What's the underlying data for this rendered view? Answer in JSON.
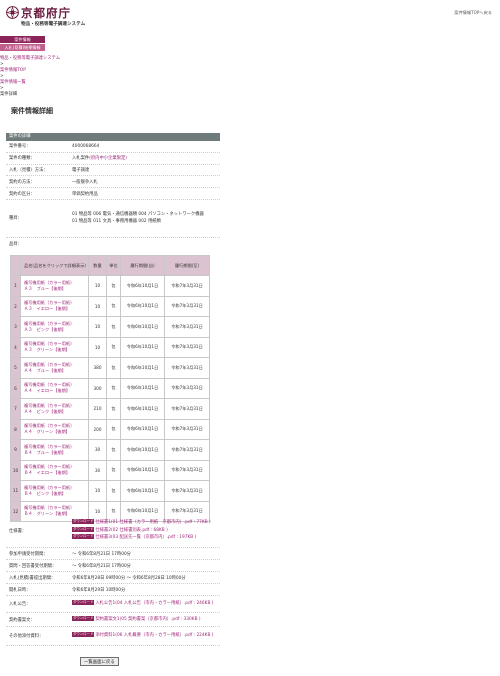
{
  "header": {
    "logo_title": "京都府庁",
    "logo_subtitle": "物品・役務等電子調達システム",
    "top_link": "案件情報TOPへ戻る"
  },
  "menu": [
    "案件情報",
    "入札(見積)結果情報"
  ],
  "breadcrumb": {
    "items": [
      "物品・役務等電子調達システム",
      "案件情報TOP",
      "案件情報一覧",
      "案件詳細"
    ],
    "separator": ">"
  },
  "page_title": "案件情報詳細",
  "detail": {
    "section_title": "案件の詳細",
    "case_number": {
      "label": "案件番号：",
      "value": "4000068664"
    },
    "case_type": {
      "label": "案件の種類：",
      "value": "入札案件",
      "tag": "(府内中小企業限定)"
    },
    "bid_method": {
      "label": "入札（見積）方法：",
      "value": "電子調達"
    },
    "contract_method": {
      "label": "契約の方法：",
      "value": "一般競争入札"
    },
    "contract_category": {
      "label": "契約の区分：",
      "value": "単価契約用品"
    },
    "category": {
      "label": "種目：",
      "line1": "01 物品等 006 電気・通信機器類 004 パソコン・ネットワーク機器",
      "line2": "01 物品等 011 文具・事務用機器 002 用紙類"
    },
    "items_label": "品目："
  },
  "items_table": {
    "headers": {
      "no": "",
      "name": "品名(品名をクリックで詳細表示)",
      "qty": "数量",
      "unit": "単位",
      "from": "履行期間(自)",
      "to": "履行期間(至)"
    },
    "rows": [
      {
        "no": "1",
        "name1": "複写機用紙（カラー用紙）",
        "name2": "Ａ３　ブルー【後期】",
        "qty": "10",
        "unit": "包",
        "from": "令和6年10月1日",
        "to": "令和7年3月31日"
      },
      {
        "no": "2",
        "name1": "複写機用紙（カラー用紙）",
        "name2": "Ａ３　イエロー【後期】",
        "qty": "10",
        "unit": "包",
        "from": "令和6年10月1日",
        "to": "令和7年3月31日"
      },
      {
        "no": "3",
        "name1": "複写機用紙（カラー用紙）",
        "name2": "Ａ３　ピンク【後期】",
        "qty": "10",
        "unit": "包",
        "from": "令和6年10月1日",
        "to": "令和7年3月31日"
      },
      {
        "no": "4",
        "name1": "複写機用紙（カラー用紙）",
        "name2": "Ａ３　グリーン【後期】",
        "qty": "10",
        "unit": "包",
        "from": "令和6年10月1日",
        "to": "令和7年3月31日"
      },
      {
        "no": "5",
        "name1": "複写機用紙（カラー用紙）",
        "name2": "Ａ４　ブルー【後期】",
        "qty": "380",
        "unit": "包",
        "from": "令和6年10月1日",
        "to": "令和7年3月31日"
      },
      {
        "no": "6",
        "name1": "複写機用紙（カラー用紙）",
        "name2": "Ａ４　イエロー【後期】",
        "qty": "300",
        "unit": "包",
        "from": "令和6年10月1日",
        "to": "令和7年3月31日"
      },
      {
        "no": "7",
        "name1": "複写機用紙（カラー用紙）",
        "name2": "Ａ４　ピンク【後期】",
        "qty": "210",
        "unit": "包",
        "from": "令和6年10月1日",
        "to": "令和7年3月31日"
      },
      {
        "no": "8",
        "name1": "複写機用紙（カラー用紙）",
        "name2": "Ａ４　グリーン【後期】",
        "qty": "200",
        "unit": "包",
        "from": "令和6年10月1日",
        "to": "令和7年3月31日"
      },
      {
        "no": "9",
        "name1": "複写機用紙（カラー用紙）",
        "name2": "Ｂ４　ブルー【後期】",
        "qty": "30",
        "unit": "包",
        "from": "令和6年10月1日",
        "to": "令和7年3月31日"
      },
      {
        "no": "10",
        "name1": "複写機用紙（カラー用紙）",
        "name2": "Ｂ４　イエロー【後期】",
        "qty": "30",
        "unit": "包",
        "from": "令和6年10月1日",
        "to": "令和7年3月31日"
      },
      {
        "no": "11",
        "name1": "複写機用紙（カラー用紙）",
        "name2": "Ｂ４　ピンク【後期】",
        "qty": "10",
        "unit": "包",
        "from": "令和6年10月1日",
        "to": "令和7年3月31日"
      },
      {
        "no": "12",
        "name1": "複写機用紙（カラー用紙）",
        "name2": "Ｂ４　グリーン【後期】",
        "qty": "10",
        "unit": "包",
        "from": "令和6年10月1日",
        "to": "令和7年3月31日"
      }
    ]
  },
  "download_badge": "ダウンロード",
  "specs": {
    "label": "仕様書：",
    "files": [
      "仕様書1(01 仕様書（カラー用紙　京都市内）.pdf : 77KB )",
      "仕様書2(02 仕様書別表.pdf : 68KB )",
      "仕様書3(03 配送先一覧（京都市内）.pdf : 197KB )"
    ]
  },
  "participation_deadline": {
    "label": "参加申請受付期間：",
    "value": "～ 令和6年8月21日 17時00分"
  },
  "question_deadline": {
    "label": "質問・回答書受付期間：",
    "value": "～ 令和6年8月21日 17時00分"
  },
  "bid_period": {
    "label": "入札(見積)書提出期間：",
    "value": "令和6年8月28日 09時00分 ～ 令和6年8月28日 10時00分"
  },
  "opening_date": {
    "label": "開札日時：",
    "value": "令和6年8月29日 10時00分"
  },
  "notice": {
    "label": "入札公告：",
    "file": "入札公告1(04 入札公告（市内・カラー用紙）.pdf : 246KB )"
  },
  "contract_doc": {
    "label": "契約書案文：",
    "file": "契約書案文1(05 契約書案（京都市内）.pdf : 330KB )"
  },
  "other": {
    "label": "その他添付資料：",
    "file": "添付資料1(06 入札概要（市内・カラー用紙）.pdf : 224KB )"
  },
  "back_button": "一覧画面に戻る",
  "colors": {
    "accent": "#8b2459",
    "link": "#a0257a",
    "table_header": "#dcc3d1",
    "section_header": "#6f7b7b"
  }
}
